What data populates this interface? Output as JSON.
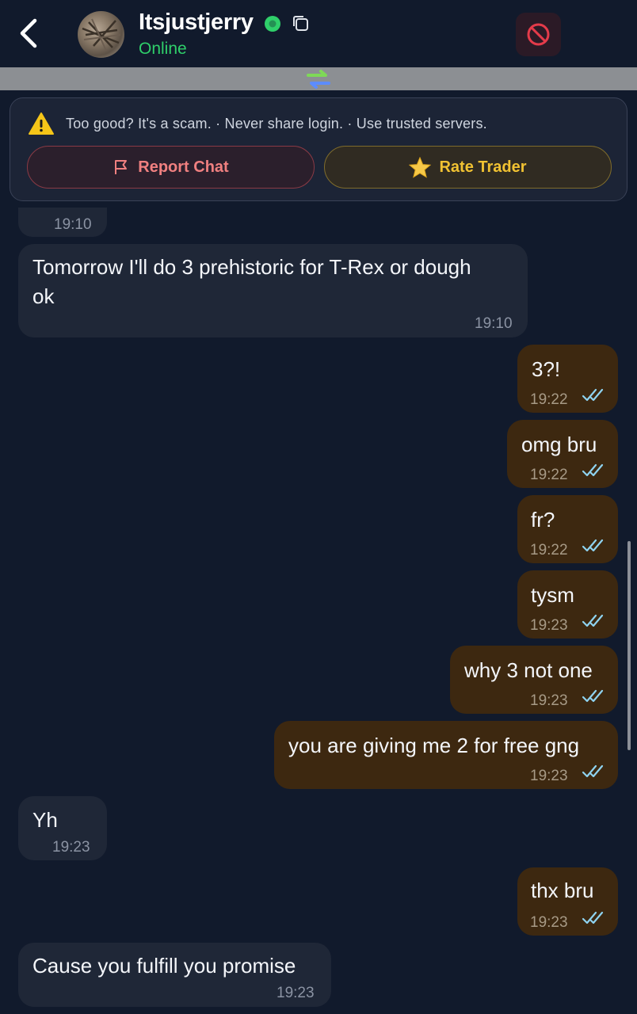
{
  "header": {
    "username": "Itsjustjerry",
    "status": "Online",
    "status_color": "#2fcf6a",
    "back_icon": "chevron-left-icon",
    "block_icon": "block-icon"
  },
  "safety": {
    "warning": "Too good? It's a scam. · Never share login. · Use trusted servers.",
    "report_label": "Report Chat",
    "rate_label": "Rate Trader"
  },
  "messages": [
    {
      "side": "in",
      "text": "",
      "time": "19:10"
    },
    {
      "side": "in",
      "text": "Tomorrow I'll do 3 prehistoric for T-Rex or dough",
      "text2": "ok",
      "time": "19:10"
    },
    {
      "side": "out",
      "text": "3?!",
      "time": "19:22"
    },
    {
      "side": "out",
      "text": "omg bru",
      "time": "19:22"
    },
    {
      "side": "out",
      "text": "fr?",
      "time": "19:22"
    },
    {
      "side": "out",
      "text": "tysm",
      "time": "19:23"
    },
    {
      "side": "out",
      "text": "why 3 not one",
      "time": "19:23"
    },
    {
      "side": "out",
      "text": "you are giving me 2 for free gng",
      "time": "19:23"
    },
    {
      "side": "in",
      "text": "Yh",
      "time": "19:23"
    },
    {
      "side": "out",
      "text": "thx bru",
      "time": "19:23"
    },
    {
      "side": "in",
      "text": "Cause you fulfill you promise",
      "time": "19:23"
    }
  ],
  "colors": {
    "background": "#111a2c",
    "incoming_bubble": "#1f2737",
    "outgoing_bubble": "#3d2810",
    "read_ticks": "#8fd3f0"
  }
}
